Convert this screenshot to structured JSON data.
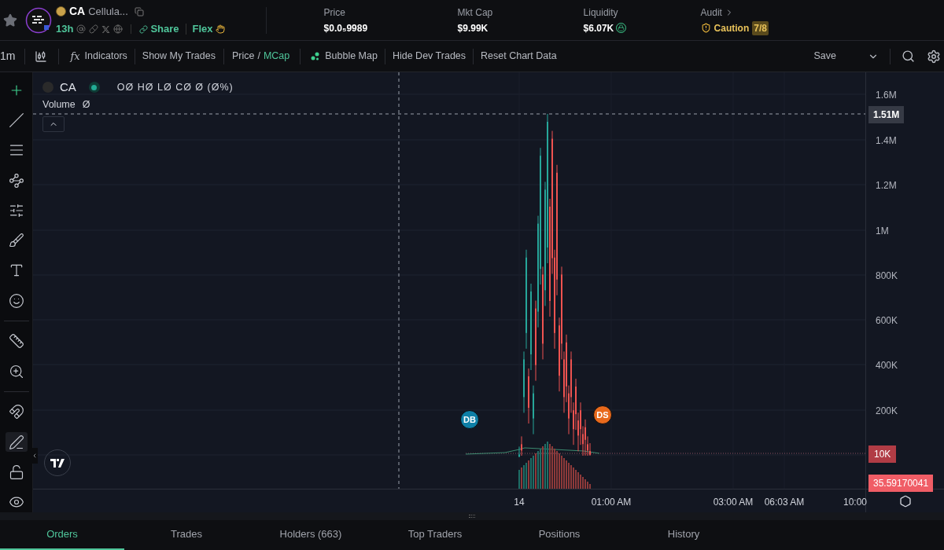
{
  "token": {
    "symbol": "CA",
    "name": "Cellula...",
    "age": "13h",
    "share": "Share",
    "flex": "Flex"
  },
  "stats": [
    {
      "label": "Price",
      "value": "$0.0₅9989"
    },
    {
      "label": "Mkt Cap",
      "value": "$9.99K"
    },
    {
      "label": "Liquidity",
      "value": "$6.07K",
      "locked": true
    }
  ],
  "audit": {
    "label": "Audit",
    "status": "Caution",
    "score": "7/8"
  },
  "toolbar": {
    "interval": "1m",
    "indicators_glyph": "fx",
    "indicators": "Indicators",
    "show_my_trades": "Show My Trades",
    "price_toggle": [
      {
        "label": "Price",
        "selected": false
      },
      {
        "label": "MCap",
        "selected": true
      }
    ],
    "separator": "/",
    "bubble_map": "Bubble Map",
    "hide_dev_trades": "Hide Dev Trades",
    "reset": "Reset Chart Data",
    "save": "Save"
  },
  "drawing_tools": [
    {
      "kind": "crosshair",
      "selected": true
    },
    {
      "kind": "trendline",
      "selected": false
    },
    {
      "kind": "lines",
      "selected": false
    },
    {
      "kind": "pattern",
      "selected": false
    },
    {
      "kind": "fib",
      "selected": false
    },
    {
      "kind": "brush",
      "selected": false
    },
    {
      "kind": "text",
      "selected": false
    },
    {
      "kind": "emoji",
      "selected": false
    },
    {
      "kind": "ruler",
      "selected": false
    },
    {
      "kind": "zoom",
      "selected": false
    },
    {
      "kind": "magnet",
      "selected": false
    },
    {
      "kind": "lockdraw",
      "selected": true
    },
    {
      "kind": "unlock",
      "selected": false
    },
    {
      "kind": "eye",
      "selected": false
    }
  ],
  "legend": {
    "symbol": "CA",
    "ohlc": "OØ HØ LØ CØ Ø (Ø%)",
    "volume_label": "Volume",
    "volume_value": "Ø"
  },
  "y_axis": [
    "1.6M",
    "1.4M",
    "1.2M",
    "1M",
    "800K",
    "600K",
    "400K",
    "200K"
  ],
  "crosshair_value": "1.51M",
  "last_value": "10K",
  "volume_value": "35.59170041",
  "x_axis": [
    "14",
    "01:00 AM",
    "03:00 AM",
    "06:03 AM",
    "10:00"
  ],
  "markers": [
    {
      "label": "DB",
      "color": "#0e7fa6"
    },
    {
      "label": "DS",
      "color": "#e8691c"
    }
  ],
  "bottom_tabs": [
    {
      "label": "Orders",
      "selected": true
    },
    {
      "label": "Trades",
      "selected": false
    },
    {
      "label": "Holders (663)",
      "selected": false
    },
    {
      "label": "Top Traders",
      "selected": false
    },
    {
      "label": "Positions",
      "selected": false
    },
    {
      "label": "History",
      "selected": false
    }
  ]
}
